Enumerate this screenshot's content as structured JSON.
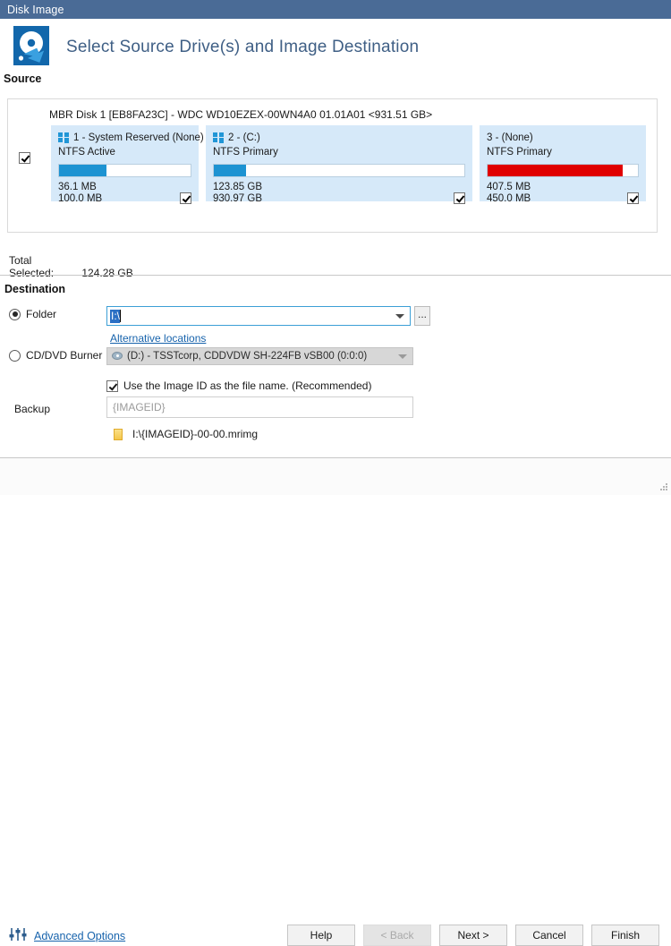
{
  "window": {
    "title": "Disk Image"
  },
  "header": {
    "title": "Select Source Drive(s) and Image Destination",
    "section_label": "Source",
    "icon": "disk-image-icon"
  },
  "source": {
    "disk_title": "MBR Disk 1 [EB8FA23C] - WDC WD10EZEX-00WN4A0 01.01A01  <931.51 GB>",
    "disk_selected": true,
    "partitions": [
      {
        "title": "1 - System Reserved (None)",
        "filesystem": "NTFS Active",
        "used": "36.1 MB",
        "total": "100.0 MB",
        "fill_percent": 36,
        "fill_color": "#1d93d2",
        "selected": true,
        "has_windows_logo": true
      },
      {
        "title": "2 -  (C:)",
        "filesystem": "NTFS Primary",
        "used": "123.85 GB",
        "total": "930.97 GB",
        "fill_percent": 13,
        "fill_color": "#1d93d2",
        "selected": true,
        "has_windows_logo": true
      },
      {
        "title": "3 -  (None)",
        "filesystem": "NTFS Primary",
        "used": "407.5 MB",
        "total": "450.0 MB",
        "fill_percent": 90,
        "fill_color": "#e00000",
        "selected": true,
        "has_windows_logo": false
      }
    ],
    "total_selected_label": "Total Selected:",
    "total_selected_value": "124.28 GB"
  },
  "destination": {
    "section_label": "Destination",
    "folder_radio_label": "Folder",
    "folder_selected": true,
    "folder_value": "I:\\",
    "folder_placeholder": "",
    "browse_label": "...",
    "alternative_locations_label": "Alternative locations",
    "cd_radio_label": "CD/DVD Burner",
    "cd_selected": false,
    "cd_value": "(D:) - TSSTcorp, CDDVDW SH-224FB  vSB00 (0:0:0)",
    "backup_label": "Backup",
    "use_image_id_label": "Use the Image ID as the file name.  (Recommended)",
    "use_image_id_checked": true,
    "file_name_placeholder": "{IMAGEID}",
    "resulting_path": "I:\\{IMAGEID}-00-00.mrimg"
  },
  "footer": {
    "advanced_options_label": "Advanced Options",
    "buttons": [
      {
        "label": "Help",
        "disabled": false
      },
      {
        "label": "< Back",
        "disabled": true
      },
      {
        "label": "Next >",
        "disabled": false
      },
      {
        "label": "Cancel",
        "disabled": false
      },
      {
        "label": "Finish",
        "disabled": false
      }
    ]
  },
  "colors": {
    "titlebar": "#4a6b96",
    "heading": "#3f5f85",
    "partition_bg": "#d6e9f9",
    "bar_blue": "#1d93d2",
    "bar_red": "#e00000",
    "link": "#1763ac"
  }
}
